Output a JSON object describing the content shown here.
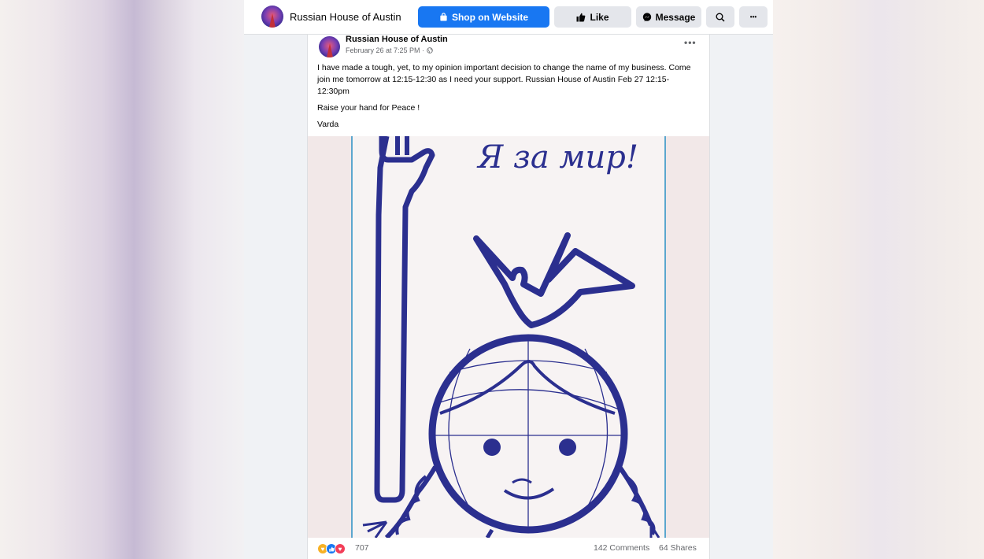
{
  "header": {
    "page_name": "Russian House of Austin",
    "shop_label": "Shop on Website",
    "like_label": "Like",
    "message_label": "Message",
    "more_label": "•••"
  },
  "post": {
    "author": "Russian House of Austin",
    "timestamp": "February 26 at 7:25 PM",
    "privacy_icon": "globe-icon",
    "options_label": "•••",
    "paragraphs": [
      "I have made a tough, yet, to my opinion important decision to change the name of my business. Come join me tomorrow at 12:15-12:30 as I need your support. Russian House of Austin Feb 27 12:15-12:30pm",
      "Raise your hand for Peace !",
      "Varda"
    ],
    "image": {
      "caption_text": "Я за мир!",
      "line_color": "#2b2f8f",
      "background": "#f7f2f2"
    },
    "reactions": {
      "count": "707",
      "types": [
        "care",
        "like",
        "love"
      ]
    },
    "comments": "142 Comments",
    "shares": "64 Shares"
  },
  "colors": {
    "accent": "#1877f2",
    "button_gray": "#e4e6eb"
  }
}
